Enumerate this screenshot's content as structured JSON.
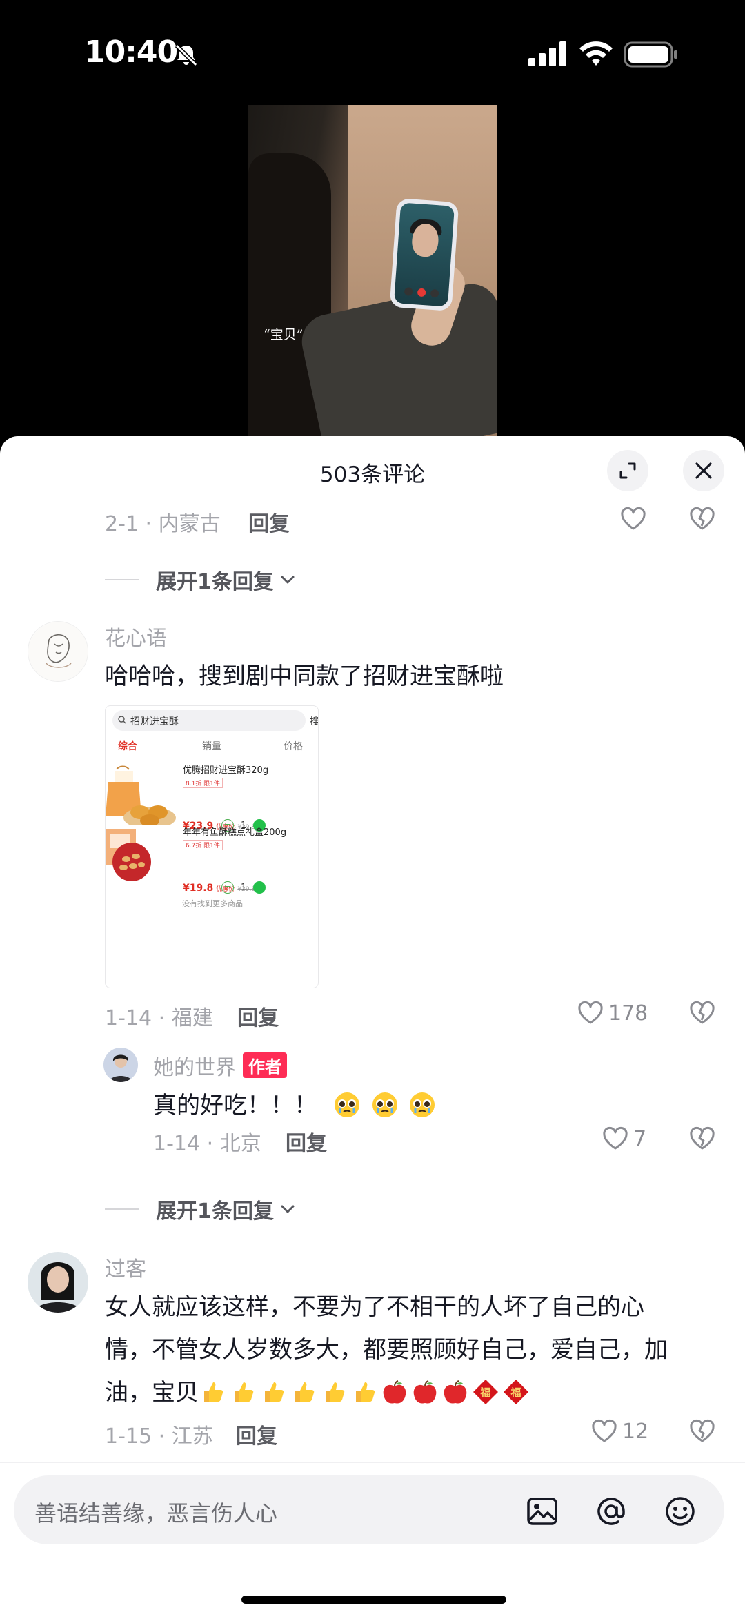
{
  "status_bar": {
    "time": "10:40",
    "icons": [
      "bell-slash-icon",
      "cell-signal-icon",
      "wifi-icon",
      "battery-icon"
    ]
  },
  "video": {
    "caption": "“宝贝”"
  },
  "sheet": {
    "title": "503条评论"
  },
  "top_meta": {
    "date_location": "2-1 · 内蒙古",
    "reply": "回复"
  },
  "expand_1": {
    "label": "展开1条回复"
  },
  "comment_1": {
    "username": "花心语",
    "text": "哈哈哈，搜到剧中同款了招财进宝酥啦",
    "date_location": "1-14 · 福建",
    "reply": "回复",
    "likes": "178",
    "screenshot": {
      "search_text": "招财进宝酥",
      "search_button": "搜",
      "tabs": [
        "综合",
        "销量",
        "价格"
      ],
      "items": [
        {
          "title": "优腾招财进宝酥320g",
          "tag": "8.1折  限1件",
          "price": "¥23.9",
          "price_label": "优惠价",
          "old_price": "¥29.8",
          "qty": "1"
        },
        {
          "title": "年年有鱼酥糕点礼盒200g",
          "tag": "6.7折  限1件",
          "price": "¥19.8",
          "price_label": "优惠价",
          "old_price": "¥29.8",
          "qty": "1"
        }
      ],
      "footer": "没有找到更多商品"
    }
  },
  "reply_1": {
    "username": "她的世界",
    "author_badge": "作者",
    "text": "真的好吃！！！",
    "emojis": [
      "pleading-face-icon",
      "pleading-face-icon",
      "pleading-face-icon"
    ],
    "date_location": "1-14 · 北京",
    "reply": "回复",
    "likes": "7"
  },
  "expand_2": {
    "label": "展开1条回复"
  },
  "comment_2": {
    "username": "过客",
    "text_line1": "女人就应该这样，不要为了不相干的人坏了自己的心",
    "text_line2": "情，不管女人岁数多大，都要照顾好自己，爱自己，加",
    "text_line3": "油，宝贝",
    "emojis": [
      "thumbs-up-icon",
      "thumbs-up-icon",
      "thumbs-up-icon",
      "thumbs-up-icon",
      "thumbs-up-icon",
      "thumbs-up-icon",
      "red-apple-icon",
      "red-apple-icon",
      "red-apple-icon",
      "fu-diamond-icon",
      "fu-diamond-icon"
    ],
    "fu_char": "福",
    "date_location": "1-15 · 江苏",
    "reply": "回复",
    "likes": "12"
  },
  "input": {
    "placeholder": "善语结善缘，恶言伤人心",
    "icons": [
      "image-icon",
      "at-icon",
      "emoji-icon"
    ]
  },
  "colors": {
    "author_badge": "#fe2c55",
    "sheet_bg": "#ffffff",
    "meta_gray": "#a3a4aa"
  }
}
